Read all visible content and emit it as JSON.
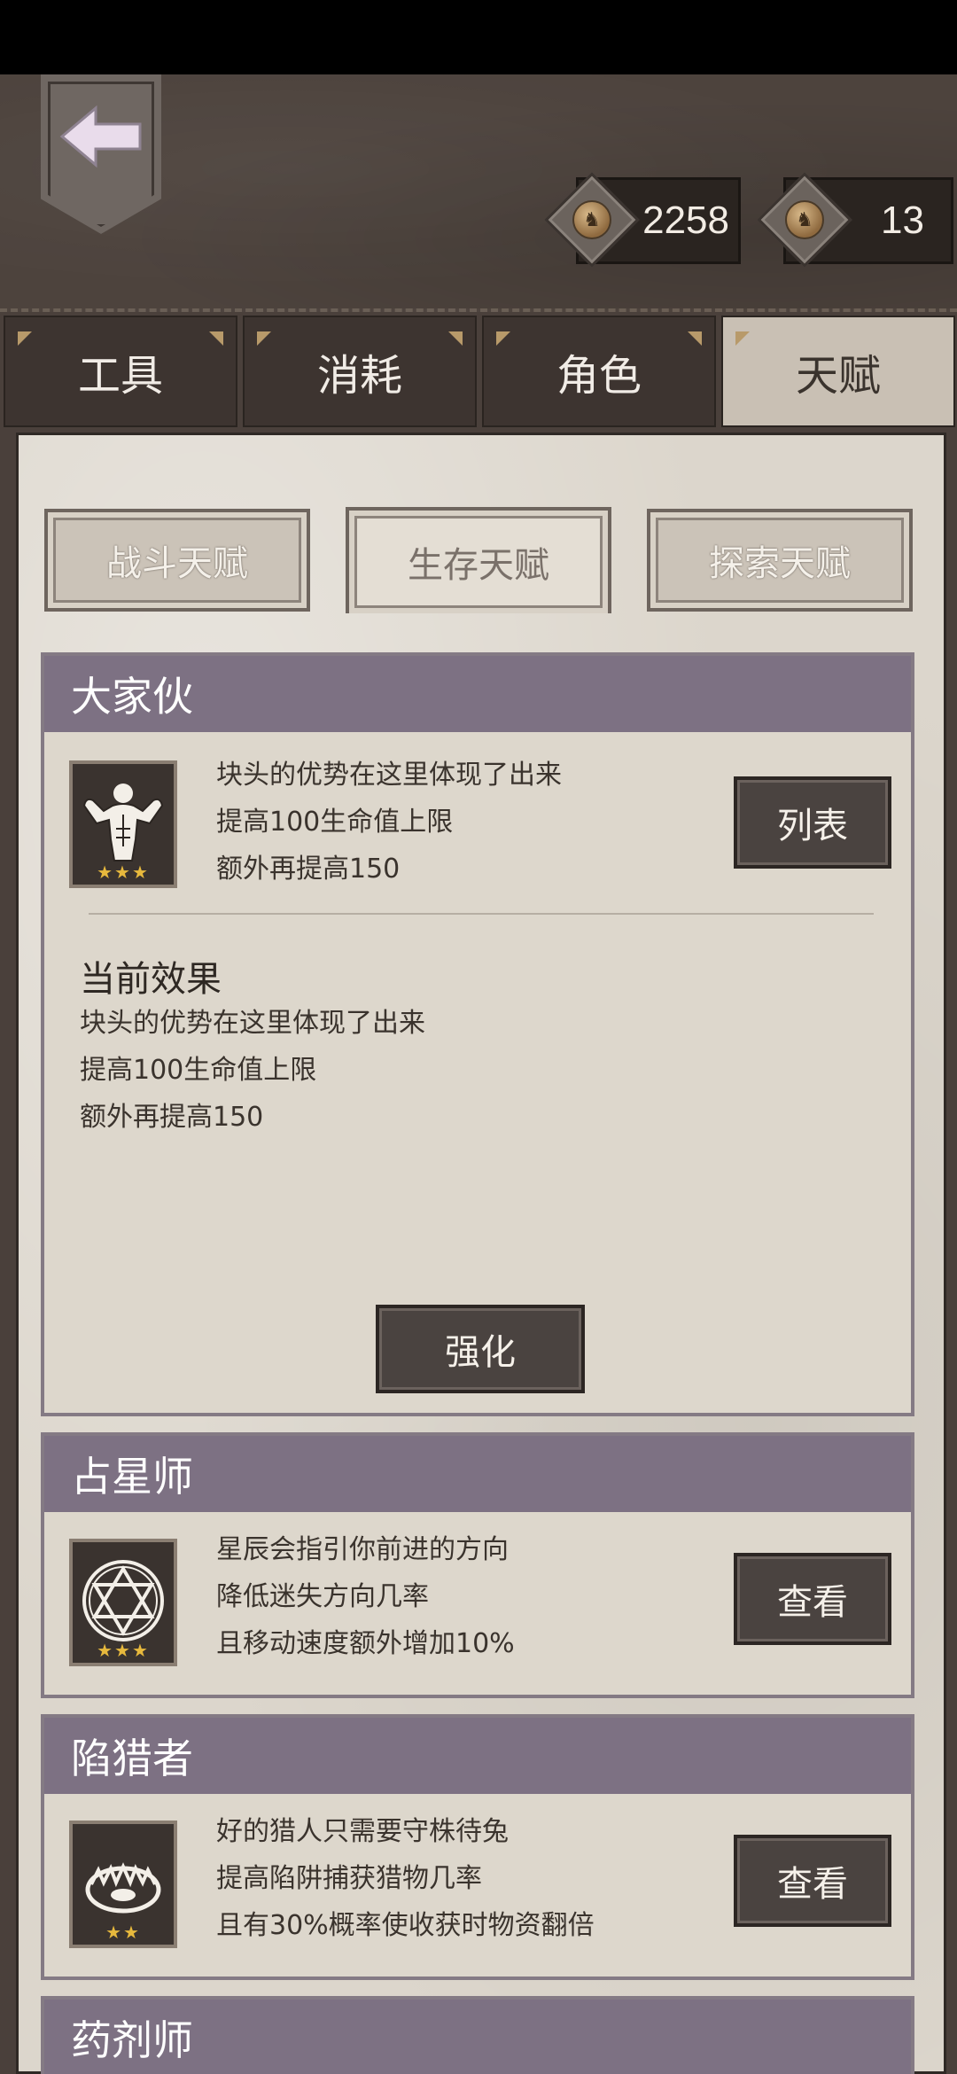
{
  "currency": {
    "coins": "2258",
    "tokens": "13"
  },
  "tabs": [
    "工具",
    "消耗",
    "角色",
    "天赋"
  ],
  "subtabs": [
    "战斗天赋",
    "生存天赋",
    "探索天赋"
  ],
  "talents": [
    {
      "title": "大家伙",
      "lines": [
        "块头的优势在这里体现了出来",
        "提高100生命值上限",
        "额外再提高150"
      ],
      "button": "列表",
      "stars": "★★★",
      "icon": "muscle-man-icon",
      "effect_title": "当前效果",
      "effect_lines": [
        "块头的优势在这里体现了出来",
        "提高100生命值上限",
        "额外再提高150"
      ],
      "upgrade_button": "强化"
    },
    {
      "title": "占星师",
      "lines": [
        "星辰会指引你前进的方向",
        "降低迷失方向几率",
        "且移动速度额外增加10%"
      ],
      "button": "查看",
      "stars": "★★★",
      "icon": "hexagram-icon"
    },
    {
      "title": "陷猎者",
      "lines": [
        "好的猎人只需要守株待兔",
        "提高陷阱捕获猎物几率",
        "且有30%概率使收获时物资翻倍"
      ],
      "button": "查看",
      "stars": "★★",
      "icon": "bear-trap-icon"
    },
    {
      "title": "药剂师"
    }
  ],
  "colors": {
    "card_header": "#7d7183",
    "star": "#e7b93d",
    "button": "#4a4340"
  }
}
